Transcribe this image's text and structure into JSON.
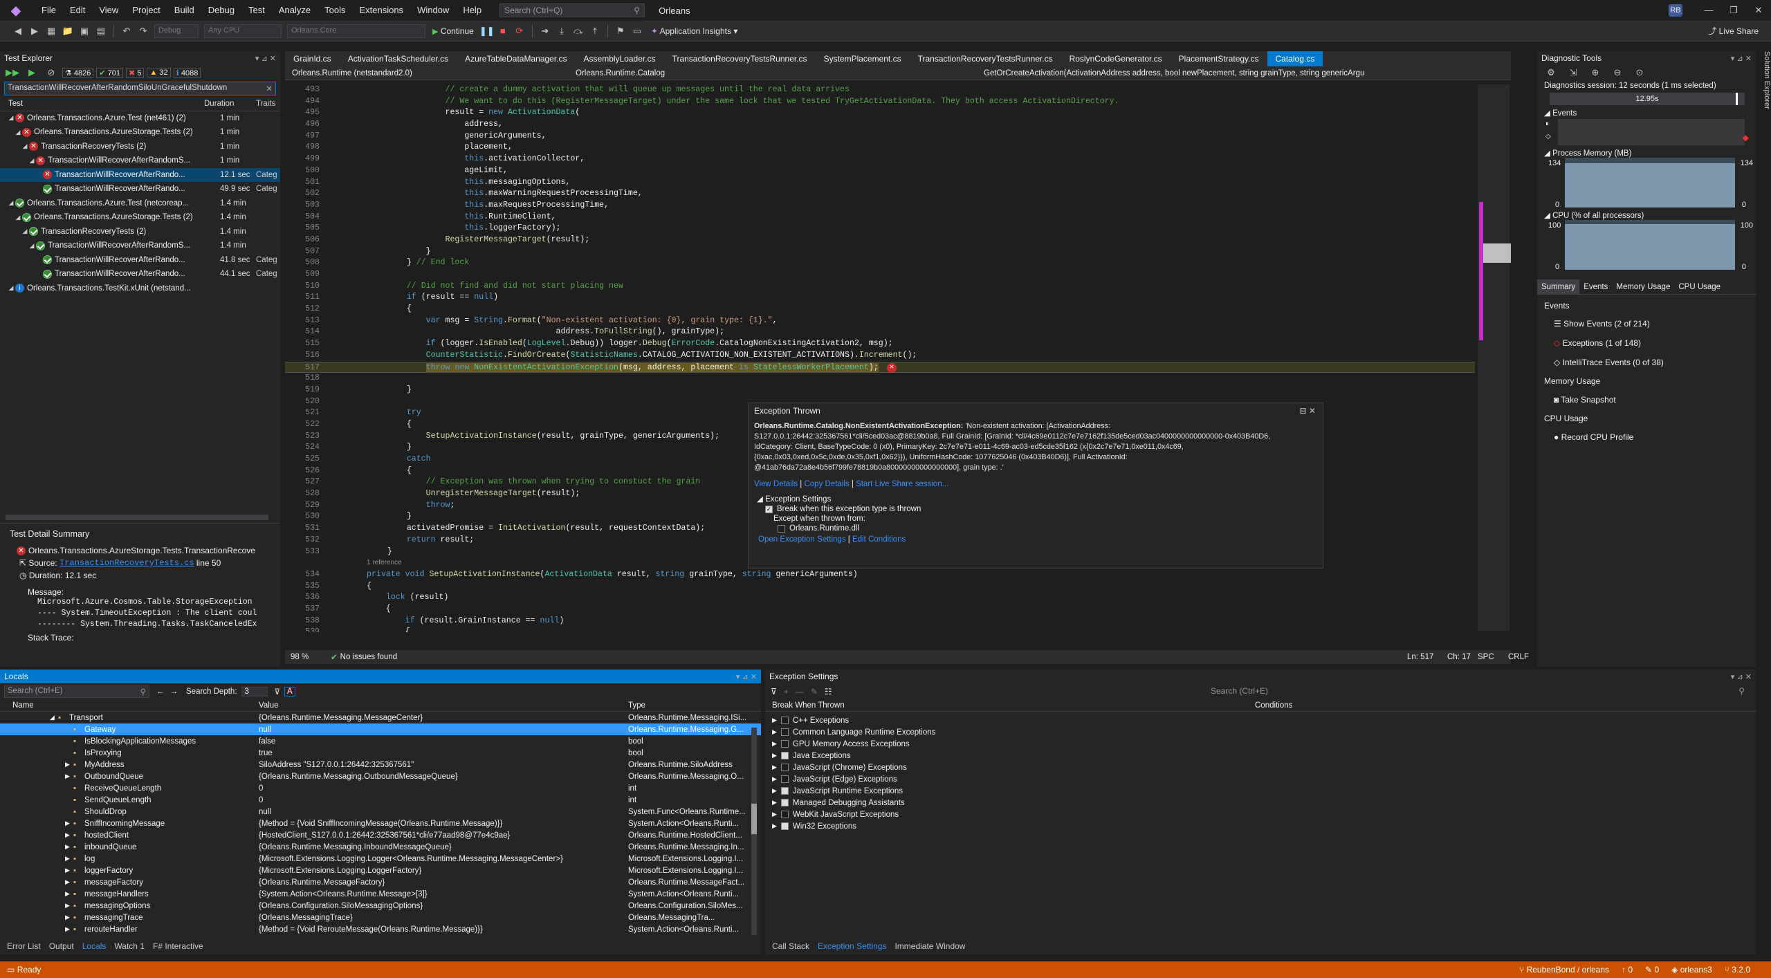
{
  "menu": [
    "File",
    "Edit",
    "View",
    "Project",
    "Build",
    "Debug",
    "Test",
    "Analyze",
    "Tools",
    "Extensions",
    "Window",
    "Help"
  ],
  "search_placeholder": "Search (Ctrl+Q)",
  "solution_name": "Orleans",
  "user_initials": "RB",
  "toolbar": {
    "config": "Debug",
    "platform": "Any CPU",
    "project": "Orleans.Core",
    "continue": "Continue",
    "app_insights": "Application Insights",
    "live_share": "Live Share"
  },
  "test_explorer": {
    "title": "Test Explorer",
    "counts": {
      "total": "4826",
      "passed": "701",
      "failed": "5",
      "warning": "32",
      "info": "4088"
    },
    "filter": "TransactionWillRecoverAfterRandomSiloUnGracefulShutdown",
    "headers": {
      "test": "Test",
      "duration": "Duration",
      "traits": "Traits"
    },
    "rows": [
      {
        "indent": 0,
        "icon": "fail",
        "name": "Orleans.Transactions.Azure.Test (net461) (2)",
        "dur": "1 min",
        "trait": ""
      },
      {
        "indent": 1,
        "icon": "fail",
        "name": "Orleans.Transactions.AzureStorage.Tests (2)",
        "dur": "1 min",
        "trait": ""
      },
      {
        "indent": 2,
        "icon": "fail",
        "name": "TransactionRecoveryTests (2)",
        "dur": "1 min",
        "trait": ""
      },
      {
        "indent": 3,
        "icon": "fail",
        "name": "TransactionWillRecoverAfterRandomS...",
        "dur": "1 min",
        "trait": ""
      },
      {
        "indent": 4,
        "icon": "fail",
        "name": "TransactionWillRecoverAfterRando...",
        "dur": "12.1 sec",
        "trait": "Categ",
        "selected": true
      },
      {
        "indent": 4,
        "icon": "pass",
        "name": "TransactionWillRecoverAfterRando...",
        "dur": "49.9 sec",
        "trait": "Categ"
      },
      {
        "indent": 0,
        "icon": "pass",
        "name": "Orleans.Transactions.Azure.Test (netcoreap...",
        "dur": "1.4 min",
        "trait": ""
      },
      {
        "indent": 1,
        "icon": "pass",
        "name": "Orleans.Transactions.AzureStorage.Tests (2)",
        "dur": "1.4 min",
        "trait": ""
      },
      {
        "indent": 2,
        "icon": "pass",
        "name": "TransactionRecoveryTests (2)",
        "dur": "1.4 min",
        "trait": ""
      },
      {
        "indent": 3,
        "icon": "pass",
        "name": "TransactionWillRecoverAfterRandomS...",
        "dur": "1.4 min",
        "trait": ""
      },
      {
        "indent": 4,
        "icon": "pass",
        "name": "TransactionWillRecoverAfterRando...",
        "dur": "41.8 sec",
        "trait": "Categ"
      },
      {
        "indent": 4,
        "icon": "pass",
        "name": "TransactionWillRecoverAfterRando...",
        "dur": "44.1 sec",
        "trait": "Categ"
      },
      {
        "indent": 0,
        "icon": "info",
        "name": "Orleans.Transactions.TestKit.xUnit (netstand...",
        "dur": "",
        "trait": ""
      }
    ],
    "detail": {
      "title": "Test Detail Summary",
      "test_name": "Orleans.Transactions.AzureStorage.Tests.TransactionRecove",
      "source_label": "Source:",
      "source_file": "TransactionRecoveryTests.cs",
      "source_line": "line 50",
      "duration": "Duration: 12.1 sec",
      "message_label": "Message:",
      "msg1": "Microsoft.Azure.Cosmos.Table.StorageException",
      "msg2": "---- System.TimeoutException : The client coul",
      "msg3": "-------- System.Threading.Tasks.TaskCanceledEx",
      "stack": "Stack Trace:"
    }
  },
  "editor": {
    "tabs": [
      "GrainId.cs",
      "ActivationTaskScheduler.cs",
      "AzureTableDataManager.cs",
      "AssemblyLoader.cs",
      "TransactionRecoveryTestsRunner.cs",
      "SystemPlacement.cs",
      "TransactionRecoveryTestsRunner.cs",
      "RoslynCodeGenerator.cs",
      "PlacementStrategy.cs",
      "Catalog.cs"
    ],
    "nav_project": "Orleans.Runtime (netstandard2.0)",
    "nav_class": "Orleans.Runtime.Catalog",
    "nav_member": "GetOrCreateActivation(ActivationAddress address, bool newPlacement, string grainType, string genericArgu",
    "zoom": "98 %",
    "issues": "No issues found",
    "ln": "Ln: 517",
    "ch": "Ch: 17",
    "spc": "SPC",
    "crlf": "CRLF",
    "ref": "1 reference"
  },
  "popup": {
    "title": "Exception Thrown",
    "exc_type": "Orleans.Runtime.Catalog.NonExistentActivationException:",
    "l1": " 'Non-existent activation: [ActivationAddress:",
    "l2": "S127.0.0.1:26442:325367561*cli/5ced03ac@8819b0a8, Full GrainId: [GrainId: *cli/4c69e0112c7e7e7162f135de5ced03ac0400000000000000-0x403B40D6,",
    "l3": "IdCategory: Client, BaseTypeCode: 0 (x0), PrimaryKey: 2c7e7e71-e011-4c69-ac03-ed5cde35f162 (x{0x2c7e7e71,0xe011,0x4c69,",
    "l4": "{0xac,0x03,0xed,0x5c,0xde,0x35,0xf1,0x62}}), UniformHashCode: 1077625046 (0x403B40D6)], Full ActivationId:",
    "l5": "@41ab76da72a8e4b56f799fe78819b0a80000000000000000], grain type: .'",
    "view_details": "View Details",
    "copy_details": "Copy Details",
    "live_share": "Start Live Share session...",
    "settings_label": "Exception Settings",
    "break_when": "Break when this exception type is thrown",
    "except_when": "Except when thrown from:",
    "dll": "Orleans.Runtime.dll",
    "open_settings": "Open Exception Settings",
    "edit_conditions": "Edit Conditions"
  },
  "diag": {
    "title": "Diagnostic Tools",
    "session": "Diagnostics session: 12 seconds (1 ms selected)",
    "timer": "12.95s",
    "events": "Events",
    "mem_title": "Process Memory (MB)",
    "mem_max": "134",
    "mem_min": "0",
    "cpu_title": "CPU (% of all processors)",
    "cpu_max": "100",
    "cpu_min": "0",
    "tabs": [
      "Summary",
      "Events",
      "Memory Usage",
      "CPU Usage"
    ],
    "ev_head": "Events",
    "show_events": "Show Events (2 of 214)",
    "exceptions": "Exceptions (1 of 148)",
    "intellitrace": "IntelliTrace Events (0 of 38)",
    "mu_head": "Memory Usage",
    "snapshot": "Take Snapshot",
    "cpu_head": "CPU Usage",
    "record": "Record CPU Profile"
  },
  "locals": {
    "title": "Locals",
    "search": "Search (Ctrl+E)",
    "depth_label": "Search Depth:",
    "depth": "3",
    "headers": {
      "name": "Name",
      "value": "Value",
      "type": "Type"
    },
    "rows": [
      {
        "n": "Transport",
        "v": "{Orleans.Runtime.Messaging.MessageCenter}",
        "t": "Orleans.Runtime.Messaging.ISi...",
        "ind": 0,
        "exp": "◢"
      },
      {
        "n": "Gateway",
        "v": "null",
        "t": "Orleans.Runtime.Messaging.G...",
        "ind": 1,
        "sel": true
      },
      {
        "n": "IsBlockingApplicationMessages",
        "v": "false",
        "t": "bool",
        "ind": 1
      },
      {
        "n": "IsProxying",
        "v": "true",
        "t": "bool",
        "ind": 1
      },
      {
        "n": "MyAddress",
        "v": "SiloAddress \"S127.0.0.1:26442:325367561\"",
        "t": "Orleans.Runtime.SiloAddress",
        "ind": 1,
        "exp": "▶"
      },
      {
        "n": "OutboundQueue",
        "v": "{Orleans.Runtime.Messaging.OutboundMessageQueue}",
        "t": "Orleans.Runtime.Messaging.O...",
        "ind": 1,
        "exp": "▶"
      },
      {
        "n": "ReceiveQueueLength",
        "v": "0",
        "t": "int",
        "ind": 1
      },
      {
        "n": "SendQueueLength",
        "v": "0",
        "t": "int",
        "ind": 1
      },
      {
        "n": "ShouldDrop",
        "v": "null",
        "t": "System.Func<Orleans.Runtime...",
        "ind": 1
      },
      {
        "n": "SniffIncomingMessage",
        "v": "{Method = {Void SniffIncomingMessage(Orleans.Runtime.Message)}}",
        "t": "System.Action<Orleans.Runti...",
        "ind": 1,
        "exp": "▶"
      },
      {
        "n": "hostedClient",
        "v": "{HostedClient_S127.0.0.1:26442:325367561*cli/e77aad98@77e4c9ae}",
        "t": "Orleans.Runtime.HostedClient...",
        "ind": 1,
        "exp": "▶"
      },
      {
        "n": "inboundQueue",
        "v": "{Orleans.Runtime.Messaging.InboundMessageQueue}",
        "t": "Orleans.Runtime.Messaging.In...",
        "ind": 1,
        "exp": "▶"
      },
      {
        "n": "log",
        "v": "{Microsoft.Extensions.Logging.Logger<Orleans.Runtime.Messaging.MessageCenter>}",
        "t": "Microsoft.Extensions.Logging.I...",
        "ind": 1,
        "exp": "▶"
      },
      {
        "n": "loggerFactory",
        "v": "{Microsoft.Extensions.Logging.LoggerFactory}",
        "t": "Microsoft.Extensions.Logging.I...",
        "ind": 1,
        "exp": "▶"
      },
      {
        "n": "messageFactory",
        "v": "{Orleans.Runtime.MessageFactory}",
        "t": "Orleans.Runtime.MessageFact...",
        "ind": 1,
        "exp": "▶"
      },
      {
        "n": "messageHandlers",
        "v": "{System.Action<Orleans.Runtime.Message>[3]}",
        "t": "System.Action<Orleans.Runti...",
        "ind": 1,
        "exp": "▶"
      },
      {
        "n": "messagingOptions",
        "v": "{Orleans.Configuration.SiloMessagingOptions}",
        "t": "Orleans.Configuration.SiloMes...",
        "ind": 1,
        "exp": "▶"
      },
      {
        "n": "messagingTrace",
        "v": "{Orleans.MessagingTrace}",
        "t": "Orleans.MessagingTra...",
        "ind": 1,
        "exp": "▶"
      },
      {
        "n": "rerouteHandler",
        "v": "{Method = {Void RerouteMessage(Orleans.Runtime.Message)}}",
        "t": "System.Action<Orleans.Runti...",
        "ind": 1,
        "exp": "▶"
      }
    ],
    "bottom_tabs": [
      "Error List",
      "Output",
      "Locals",
      "Watch 1",
      "F# Interactive"
    ]
  },
  "exc_settings": {
    "title": "Exception Settings",
    "search": "Search (Ctrl+E)",
    "h_break": "Break When Thrown",
    "h_cond": "Conditions",
    "items": [
      {
        "label": "C++ Exceptions",
        "on": false
      },
      {
        "label": "Common Language Runtime Exceptions",
        "on": false
      },
      {
        "label": "GPU Memory Access Exceptions",
        "on": false
      },
      {
        "label": "Java Exceptions",
        "on": true
      },
      {
        "label": "JavaScript (Chrome) Exceptions",
        "on": false
      },
      {
        "label": "JavaScript (Edge) Exceptions",
        "on": false
      },
      {
        "label": "JavaScript Runtime Exceptions",
        "on": true
      },
      {
        "label": "Managed Debugging Assistants",
        "on": true
      },
      {
        "label": "WebKit JavaScript Exceptions",
        "on": false
      },
      {
        "label": "Win32 Exceptions",
        "on": true
      }
    ],
    "bottom_tabs": [
      "Call Stack",
      "Exception Settings",
      "Immediate Window"
    ]
  },
  "status": {
    "ready": "Ready",
    "repo": "ReubenBond / orleans",
    "up": "0",
    "pencil": "0",
    "branch": "orleans3",
    "version": "3.2.0"
  },
  "colors": {
    "accent": "#007acc",
    "status": "#ca5100",
    "error": "#c72e2e",
    "pass": "#388a34"
  }
}
